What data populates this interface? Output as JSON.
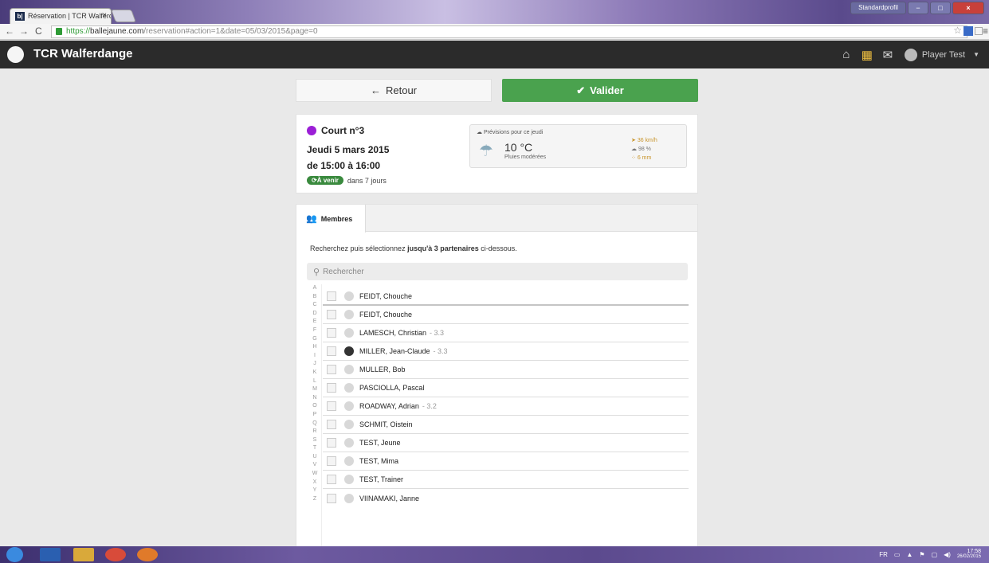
{
  "browser": {
    "tab_title": "Réservation | TCR Walferd",
    "tab_favicon": "b|",
    "tab_close": "×",
    "profile": "Standardprofil",
    "url_https": "https://",
    "url_domain": "ballejaune.com",
    "url_path": "/reservation#action=1&date=05/03/2015&page=0"
  },
  "app": {
    "brand": "TCR Walferdange",
    "user_name": "Player Test",
    "nav_icons": [
      "home-icon",
      "calendar-icon",
      "envelope-icon"
    ]
  },
  "actions": {
    "back_label": "Retour",
    "validate_label": "Valider"
  },
  "reservation": {
    "court": "Court n°3",
    "court_color": "#9b1fd6",
    "date": "Jeudi 5 mars 2015",
    "hours": "de 15:00 à 16:00",
    "status_badge": "À venir",
    "relative": "dans 7 jours"
  },
  "weather": {
    "title": "Prévisions pour ce jeudi",
    "temperature": "10 °C",
    "description": "Pluies modérées",
    "wind": "36 km/h",
    "humidity": "98 %",
    "rain": "6 mm"
  },
  "members": {
    "tab_label": "Membres",
    "instruction_pre": "Recherchez puis sélectionnez ",
    "instruction_bold": "jusqu'à 3 partenaires",
    "instruction_post": " ci-dessous.",
    "search_placeholder": "Rechercher",
    "alphabet": [
      "A",
      "B",
      "C",
      "D",
      "E",
      "F",
      "G",
      "H",
      "I",
      "J",
      "K",
      "L",
      "M",
      "N",
      "O",
      "P",
      "Q",
      "R",
      "S",
      "T",
      "U",
      "V",
      "W",
      "X",
      "Y",
      "Z"
    ],
    "list": [
      {
        "name": "FEIDT, Chouche",
        "level": ""
      },
      {
        "name": "FEIDT, Chouche",
        "level": ""
      },
      {
        "name": "LAMESCH, Christian",
        "level": "- 3.3"
      },
      {
        "name": "MILLER, Jean-Claude",
        "level": "- 3.3"
      },
      {
        "name": "MULLER, Bob",
        "level": ""
      },
      {
        "name": "PASCIOLLA, Pascal",
        "level": ""
      },
      {
        "name": "ROADWAY, Adrian",
        "level": "- 3.2"
      },
      {
        "name": "SCHMIT, Oistein",
        "level": ""
      },
      {
        "name": "TEST, Jeune",
        "level": ""
      },
      {
        "name": "TEST, Mima",
        "level": ""
      },
      {
        "name": "TEST, Trainer",
        "level": ""
      },
      {
        "name": "VIINAMAKI, Janne",
        "level": ""
      }
    ]
  },
  "taskbar": {
    "lang": "FR",
    "time": "17:58",
    "date": "26/02/2015"
  }
}
